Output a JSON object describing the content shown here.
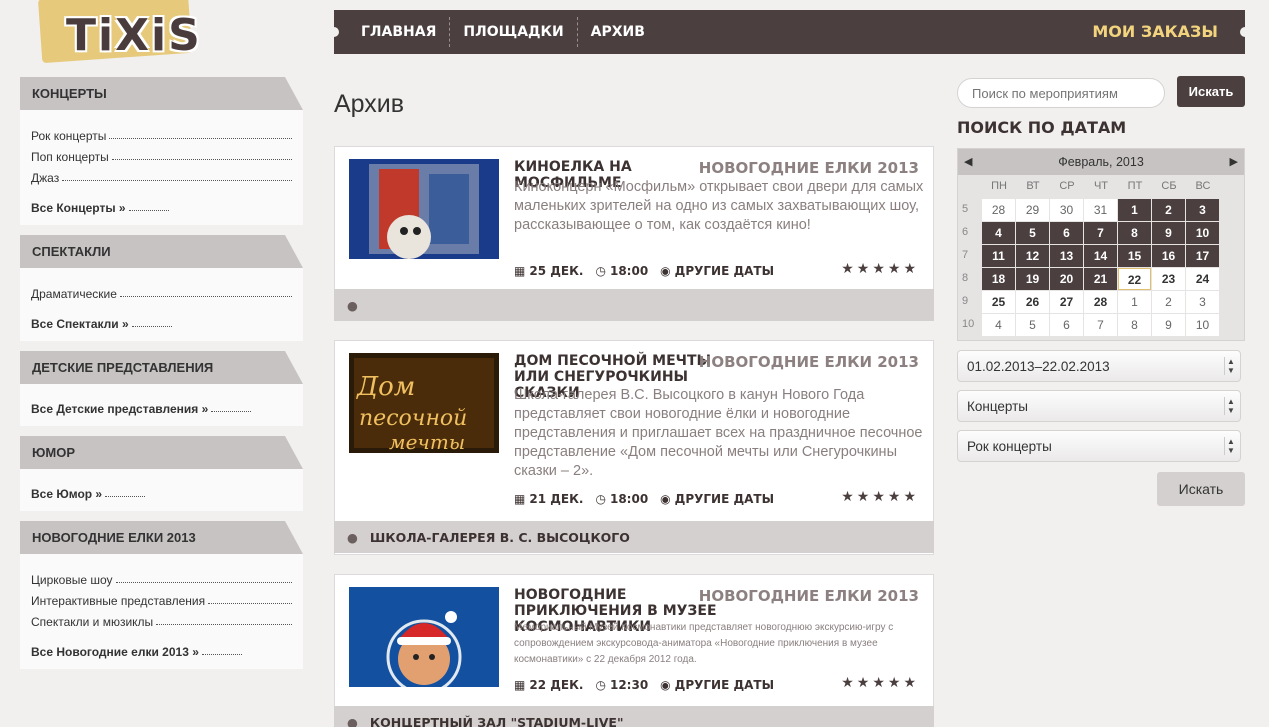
{
  "logo": {
    "text": "TiXiS"
  },
  "nav": {
    "items": [
      "ГЛАВНАЯ",
      "ПЛОЩАДКИ",
      "АРХИВ"
    ],
    "orders": "МОИ ЗАКАЗЫ"
  },
  "sidebar": [
    {
      "title": "КОНЦЕРТЫ",
      "links": [
        "Рок концерты",
        "Поп концерты",
        "Джаз"
      ],
      "all": "Все Концерты »"
    },
    {
      "title": "СПЕКТАКЛИ",
      "links": [
        "Драматические"
      ],
      "all": "Все Спектакли »"
    },
    {
      "title": "ДЕТСКИЕ ПРЕДСТАВЛЕНИЯ",
      "links": [],
      "all": "Все Детские представления »"
    },
    {
      "title": "ЮМОР",
      "links": [],
      "all": "Все Юмор »"
    },
    {
      "title": "НОВОГОДНИЕ ЕЛКИ 2013",
      "links": [
        "Цирковые шоу",
        "Интерактивные представления",
        "Спектакли и мюзиклы"
      ],
      "all": "Все Новогодние елки 2013 »"
    }
  ],
  "main": {
    "title": "Архив",
    "events": [
      {
        "title": "КИНОЕЛКА НА МОСФИЛЬМЕ",
        "category": "НОВОГОДНИЕ ЕЛКИ 2013",
        "description": "Киноконцерн «Мосфильм» открывает свои двери для самых маленьких зрителей на одно из самых захватывающих шоу, рассказывающее о том, как создаётся кино!",
        "date": "25 ДЕК.",
        "time": "18:00",
        "other_dates": "ДРУГИЕ ДАТЫ",
        "stars": "★★★★★",
        "venue": ""
      },
      {
        "title": "ДОМ ПЕСОЧНОЙ МЕЧТЫ ИЛИ СНЕГУРОЧКИНЫ СКАЗКИ",
        "category": "НОВОГОДНИЕ ЕЛКИ 2013",
        "description": "Школа-галерея В.С. Высоцкого в канун Нового Года представляет свои новогодние ёлки и новогодние представления и приглашает всех на праздничное песочное представление «Дом песочной мечты или Снегурочкины сказки – 2».",
        "date": "21 ДЕК.",
        "time": "18:00",
        "other_dates": "ДРУГИЕ ДАТЫ",
        "stars": "★★★★★",
        "venue": "ШКОЛА-ГАЛЕРЕЯ В. С. ВЫСОЦКОГО",
        "thumb_text": "Дом песочной мечты"
      },
      {
        "title": "НОВОГОДНИЕ ПРИКЛЮЧЕНИЯ В МУЗЕЕ КОСМОНАВТИКИ",
        "category": "НОВОГОДНИЕ ЕЛКИ 2013",
        "description": "Мемориальный Музей Космонавтики представляет новогоднюю экскурсию-игру с сопровождением экскурсовода-аниматора «Новогодние приключения в музее космонавтики» с 22 декабря 2012 года.",
        "date": "22 ДЕК.",
        "time": "12:30",
        "other_dates": "ДРУГИЕ ДАТЫ",
        "stars": "★★★★★",
        "venue": "КОНЦЕРТНЫЙ ЗАЛ \"STADIUM-LIVE\""
      }
    ]
  },
  "right": {
    "search_placeholder": "Поиск по мероприятиям",
    "search_button": "Искать",
    "dates_heading": "ПОИСК ПО ДАТАМ",
    "calendar": {
      "month": "Февраль, 2013",
      "weekdays": [
        "ПН",
        "ВТ",
        "СР",
        "ЧТ",
        "ПТ",
        "СБ",
        "ВС"
      ],
      "weeks": [
        {
          "num": "5",
          "days": [
            [
              "28",
              "out"
            ],
            [
              "29",
              "out"
            ],
            [
              "30",
              "out"
            ],
            [
              "31",
              "out"
            ],
            [
              "1",
              "avail"
            ],
            [
              "2",
              "avail"
            ],
            [
              "3",
              "avail"
            ]
          ]
        },
        {
          "num": "6",
          "days": [
            [
              "4",
              "avail"
            ],
            [
              "5",
              "avail"
            ],
            [
              "6",
              "avail"
            ],
            [
              "7",
              "avail"
            ],
            [
              "8",
              "avail"
            ],
            [
              "9",
              "avail"
            ],
            [
              "10",
              "avail"
            ]
          ]
        },
        {
          "num": "7",
          "days": [
            [
              "11",
              "avail"
            ],
            [
              "12",
              "avail"
            ],
            [
              "13",
              "avail"
            ],
            [
              "14",
              "avail"
            ],
            [
              "15",
              "avail"
            ],
            [
              "16",
              "avail"
            ],
            [
              "17",
              "avail"
            ]
          ]
        },
        {
          "num": "8",
          "days": [
            [
              "18",
              "avail"
            ],
            [
              "19",
              "avail"
            ],
            [
              "20",
              "avail"
            ],
            [
              "21",
              "avail"
            ],
            [
              "22",
              "today"
            ],
            [
              "23",
              "past"
            ],
            [
              "24",
              "past"
            ]
          ]
        },
        {
          "num": "9",
          "days": [
            [
              "25",
              "past"
            ],
            [
              "26",
              "past"
            ],
            [
              "27",
              "past"
            ],
            [
              "28",
              "past"
            ],
            [
              "1",
              "out"
            ],
            [
              "2",
              "out"
            ],
            [
              "3",
              "out"
            ]
          ]
        },
        {
          "num": "10",
          "days": [
            [
              "4",
              "out"
            ],
            [
              "5",
              "out"
            ],
            [
              "6",
              "out"
            ],
            [
              "7",
              "out"
            ],
            [
              "8",
              "out"
            ],
            [
              "9",
              "out"
            ],
            [
              "10",
              "out"
            ]
          ]
        }
      ]
    },
    "date_range": "01.02.2013–22.02.2013",
    "category_select": "Концерты",
    "subcategory_select": "Рок концерты",
    "submit_button": "Искать"
  },
  "colors": {
    "dark": "#4b3f3f",
    "accent": "#f3d47e",
    "panel": "#c8c3c3"
  }
}
